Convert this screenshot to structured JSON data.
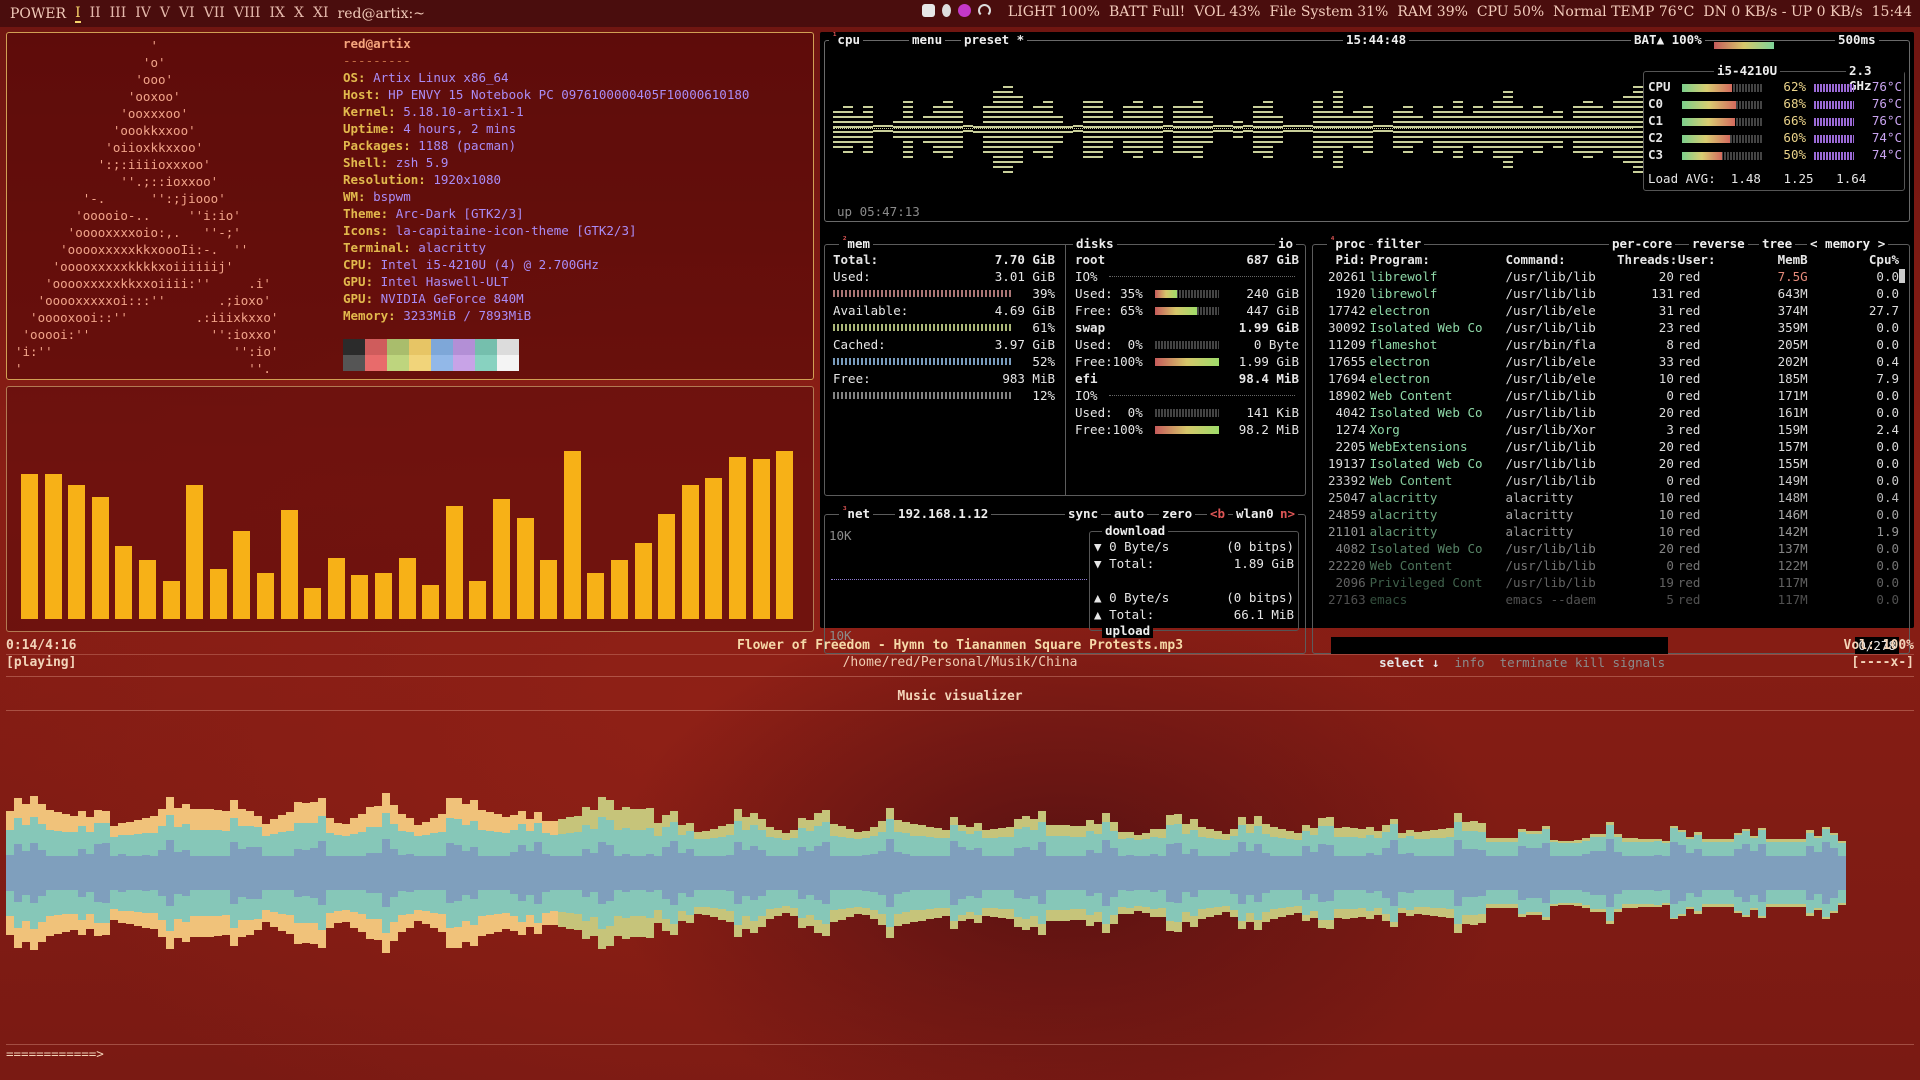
{
  "bar": {
    "power": "POWER",
    "workspaces": [
      "I",
      "II",
      "III",
      "IV",
      "V",
      "VI",
      "VII",
      "VIII",
      "IX",
      "X",
      "XI"
    ],
    "active_ws": 0,
    "window": "red@artix:~",
    "status": [
      "LIGHT 100%",
      "BATT Full!",
      "VOL 43%",
      "File System 31%",
      "RAM 39%",
      "CPU 50%",
      "Normal TEMP 76°C",
      "DN 0 KB/s - UP 0 KB/s",
      "15:44"
    ]
  },
  "neofetch": {
    "ascii": "                  '\n                 'o'\n                'ooo'\n               'ooxoo'\n              'ooxxxoo'\n             'oookkxxoo'\n            'oiioxkkxxoo'\n           ':;:iiiioxxxoo'\n              ''.;::ioxxoo'\n         '-.      '':;jiooo'\n        'ooooio-..     ''i:io'\n       'ooooxxxxoio:,.   ''-;'\n      'ooooxxxxxkkxoooIi:-.  ''\n     'ooooxxxxxkkkkxoiiiiiij'\n    'ooooxxxxxkkxxoiiii:''     .i'\n   'ooooxxxxxoi:::''       .;ioxo'\n  'ooooxooi::''         .:iiixkxxo'\n 'ooooi:''                '':ioxxo'\n'i:''                        '':io'\n'                              ''.",
    "user": "red@artix",
    "sep": "---------",
    "rows": [
      {
        "k": "OS:",
        "v": "Artix Linux x86_64"
      },
      {
        "k": "Host:",
        "v": "HP ENVY 15 Notebook PC 0976100000405F10000610180"
      },
      {
        "k": "Kernel:",
        "v": "5.18.10-artix1-1"
      },
      {
        "k": "Uptime:",
        "v": "4 hours, 2 mins"
      },
      {
        "k": "Packages:",
        "v": "1188 (pacman)"
      },
      {
        "k": "Shell:",
        "v": "zsh 5.9"
      },
      {
        "k": "Resolution:",
        "v": "1920x1080"
      },
      {
        "k": "WM:",
        "v": "bspwm"
      },
      {
        "k": "Theme:",
        "v": "Arc-Dark [GTK2/3]"
      },
      {
        "k": "Icons:",
        "v": "la-capitaine-icon-theme [GTK2/3]"
      },
      {
        "k": "Terminal:",
        "v": "alacritty"
      },
      {
        "k": "CPU:",
        "v": "Intel i5-4210U (4) @ 2.700GHz"
      },
      {
        "k": "GPU:",
        "v": "Intel Haswell-ULT"
      },
      {
        "k": "GPU:",
        "v": "NVIDIA GeForce 840M"
      },
      {
        "k": "Memory:",
        "v": "3233MiB / 7893MiB"
      }
    ],
    "palette": [
      "#2b2b2b",
      "#cf5c5c",
      "#a9bd6c",
      "#e7c565",
      "#7ea7d8",
      "#b38fd6",
      "#75bfad",
      "#dcdcdc",
      "#555555",
      "#e86b6b",
      "#bed57e",
      "#f1d47a",
      "#92b8e8",
      "#c8a3e7",
      "#88d2c0",
      "#f4f4f4"
    ]
  },
  "cava": {
    "levels": [
      0.69,
      0.69,
      0.64,
      0.58,
      0.35,
      0.28,
      0.18,
      0.64,
      0.24,
      0.42,
      0.22,
      0.52,
      0.15,
      0.29,
      0.21,
      0.22,
      0.29,
      0.16,
      0.54,
      0.18,
      0.57,
      0.48,
      0.28,
      0.8,
      0.22,
      0.28,
      0.36,
      0.5,
      0.64,
      0.67,
      0.77,
      0.76,
      0.8
    ]
  },
  "btop": {
    "cpu": {
      "title": "cpu",
      "menu": "menu",
      "preset": "preset *",
      "clock": "15:44:48",
      "bat": "BAT▲ 100%",
      "interval": "500ms",
      "uptime": "up 05:47:13",
      "model": "i5-4210U",
      "freq": "2.3 GHz",
      "cores": [
        {
          "name": "CPU",
          "pct": "62%",
          "temp": "76°C",
          "load": 0.62
        },
        {
          "name": "C0",
          "pct": "68%",
          "temp": "76°C",
          "load": 0.68
        },
        {
          "name": "C1",
          "pct": "66%",
          "temp": "76°C",
          "load": 0.66
        },
        {
          "name": "C2",
          "pct": "60%",
          "temp": "74°C",
          "load": 0.6
        },
        {
          "name": "C3",
          "pct": "50%",
          "temp": "74°C",
          "load": 0.5
        }
      ],
      "load_label": "Load AVG:",
      "load": [
        "1.48",
        "1.25",
        "1.64"
      ],
      "history": [
        0.4,
        0.5,
        0.3,
        0.5,
        0,
        0,
        0.2,
        0.6,
        0.2,
        0.3,
        0.5,
        0.6,
        0.4,
        0,
        0.1,
        0.5,
        0.8,
        0.9,
        0.7,
        0.4,
        0.5,
        0.6,
        0.3,
        0.1,
        0,
        0.6,
        0.6,
        0.4,
        0.2,
        0.5,
        0.6,
        0.4,
        0.5,
        0,
        0.5,
        0.5,
        0.6,
        0.3,
        0,
        0,
        0.2,
        0,
        0.5,
        0.6,
        0.3,
        0,
        0,
        0,
        0.6,
        0.4,
        0.8,
        0.3,
        0.4,
        0.5,
        0,
        0,
        0.4,
        0.5,
        0.3,
        0.2,
        0.5,
        0.4,
        0.6,
        0.3,
        0.5,
        0.4,
        0.6,
        0.8,
        0.5,
        0.4,
        0.5,
        0.3,
        0.4,
        0.2,
        0.5,
        0.6,
        0.5,
        0.4,
        0.6,
        0.7,
        0.9
      ]
    },
    "mem": {
      "title": "mem",
      "rows": [
        {
          "k": "Total:",
          "v": "7.70 GiB"
        },
        {
          "k": "Used:",
          "v": "3.01 GiB",
          "pct": "39%",
          "frac": 0.39
        },
        {
          "k": "Available:",
          "v": "4.69 GiB",
          "pct": "61%",
          "frac": 0.61
        },
        {
          "k": "Cached:",
          "v": "3.97 GiB",
          "pct": "52%",
          "frac": 0.52
        },
        {
          "k": "Free:",
          "v": "983 MiB",
          "pct": "12%",
          "frac": 0.12
        }
      ]
    },
    "disks": {
      "title": "disks",
      "io": "io",
      "groups": [
        {
          "name": "root",
          "size": "687 GiB",
          "lines": [
            {
              "k": "IO%",
              "v": ""
            },
            {
              "k": "Used: 35%",
              "v": "240 GiB",
              "frac": 0.35
            },
            {
              "k": "Free: 65%",
              "v": "447 GiB",
              "frac": 0.65
            }
          ]
        },
        {
          "name": "swap",
          "size": "1.99 GiB",
          "lines": [
            {
              "k": "Used:  0%",
              "v": "0 Byte",
              "frac": 0
            },
            {
              "k": "Free:100%",
              "v": "1.99 GiB",
              "frac": 1
            }
          ]
        },
        {
          "name": "efi",
          "size": "98.4 MiB",
          "lines": [
            {
              "k": "IO%",
              "v": ""
            },
            {
              "k": "Used:  0%",
              "v": "141 KiB",
              "frac": 0
            },
            {
              "k": "Free:100%",
              "v": "98.2 MiB",
              "frac": 1
            }
          ]
        }
      ]
    },
    "net": {
      "title": "net",
      "ip": "192.168.1.12",
      "sync": "sync",
      "auto": "auto",
      "zero": "zero",
      "b": "<b",
      "iface": "wlan0",
      "n": "n>",
      "scale_top": "10K",
      "scale_bottom": "10K",
      "download": "download",
      "upload": "upload",
      "dl_rate": "0 Byte/s",
      "dl_bits": "(0 bitps)",
      "dl_total_k": "Total:",
      "dl_total": "1.89 GiB",
      "ul_rate": "0 Byte/s",
      "ul_bits": "(0 bitps)",
      "ul_total_k": "Total:",
      "ul_total": "66.1 MiB"
    },
    "proc": {
      "title": "proc",
      "filter": "filter",
      "per_core": "per-core",
      "reverse": "reverse",
      "tree": "tree",
      "sort": "< memory >",
      "headers": [
        "Pid:",
        "Program:",
        "Command:",
        "Threads:",
        "User:",
        "MemB",
        "Cpu%"
      ],
      "rows": [
        [
          "20261",
          "librewolf",
          "/usr/lib/lib",
          "20",
          "red",
          "7.5G",
          "0.0"
        ],
        [
          "1920",
          "librewolf",
          "/usr/lib/lib",
          "131",
          "red",
          "643M",
          "0.0"
        ],
        [
          "17742",
          "electron",
          "/usr/lib/ele",
          "31",
          "red",
          "374M",
          "27.7"
        ],
        [
          "30092",
          "Isolated Web Co",
          "/usr/lib/lib",
          "23",
          "red",
          "359M",
          "0.0"
        ],
        [
          "11209",
          "flameshot",
          "/usr/bin/fla",
          "8",
          "red",
          "205M",
          "0.0"
        ],
        [
          "17655",
          "electron",
          "/usr/lib/ele",
          "33",
          "red",
          "202M",
          "0.4"
        ],
        [
          "17694",
          "electron",
          "/usr/lib/ele",
          "10",
          "red",
          "185M",
          "7.9"
        ],
        [
          "18902",
          "Web Content",
          "/usr/lib/lib",
          "0",
          "red",
          "171M",
          "0.0"
        ],
        [
          "4042",
          "Isolated Web Co",
          "/usr/lib/lib",
          "20",
          "red",
          "161M",
          "0.0"
        ],
        [
          "1274",
          "Xorg",
          "/usr/lib/Xor",
          "3",
          "red",
          "159M",
          "2.4"
        ],
        [
          "2205",
          "WebExtensions",
          "/usr/lib/lib",
          "20",
          "red",
          "157M",
          "0.0"
        ],
        [
          "19137",
          "Isolated Web Co",
          "/usr/lib/lib",
          "20",
          "red",
          "155M",
          "0.0"
        ],
        [
          "23392",
          "Web Content",
          "/usr/lib/lib",
          "0",
          "red",
          "149M",
          "0.0"
        ],
        [
          "25047",
          "alacritty",
          "alacritty",
          "10",
          "red",
          "148M",
          "0.4"
        ],
        [
          "24859",
          "alacritty",
          "alacritty",
          "10",
          "red",
          "146M",
          "0.0"
        ],
        [
          "21101",
          "alacritty",
          "alacritty",
          "10",
          "red",
          "142M",
          "1.9"
        ],
        [
          "4082",
          "Isolated Web Co",
          "/usr/lib/lib",
          "20",
          "red",
          "137M",
          "0.0"
        ],
        [
          "22220",
          "Web Content",
          "/usr/lib/lib",
          "0",
          "red",
          "122M",
          "0.0"
        ],
        [
          "2096",
          "Privileged Cont",
          "/usr/lib/lib",
          "19",
          "red",
          "117M",
          "0.0"
        ],
        [
          "27163",
          "emacs",
          "emacs --daem",
          "5",
          "red",
          "117M",
          "0.0"
        ]
      ],
      "footer": {
        "select": "select ↓",
        "info": "info",
        "terminate": "terminate",
        "kill": "kill",
        "signals": "signals",
        "count": "0/278"
      }
    }
  },
  "music": {
    "time": "0:14/4:16",
    "state": "[playing]",
    "title": "Flower of Freedom - Hymn to Tiananmen Square Protests.mp3",
    "path": "/home/red/Personal/Musik/China",
    "vol": "Vol: 100%",
    "flags": "[----x-]",
    "vis_label": "Music visualizer",
    "progress": "============>"
  }
}
